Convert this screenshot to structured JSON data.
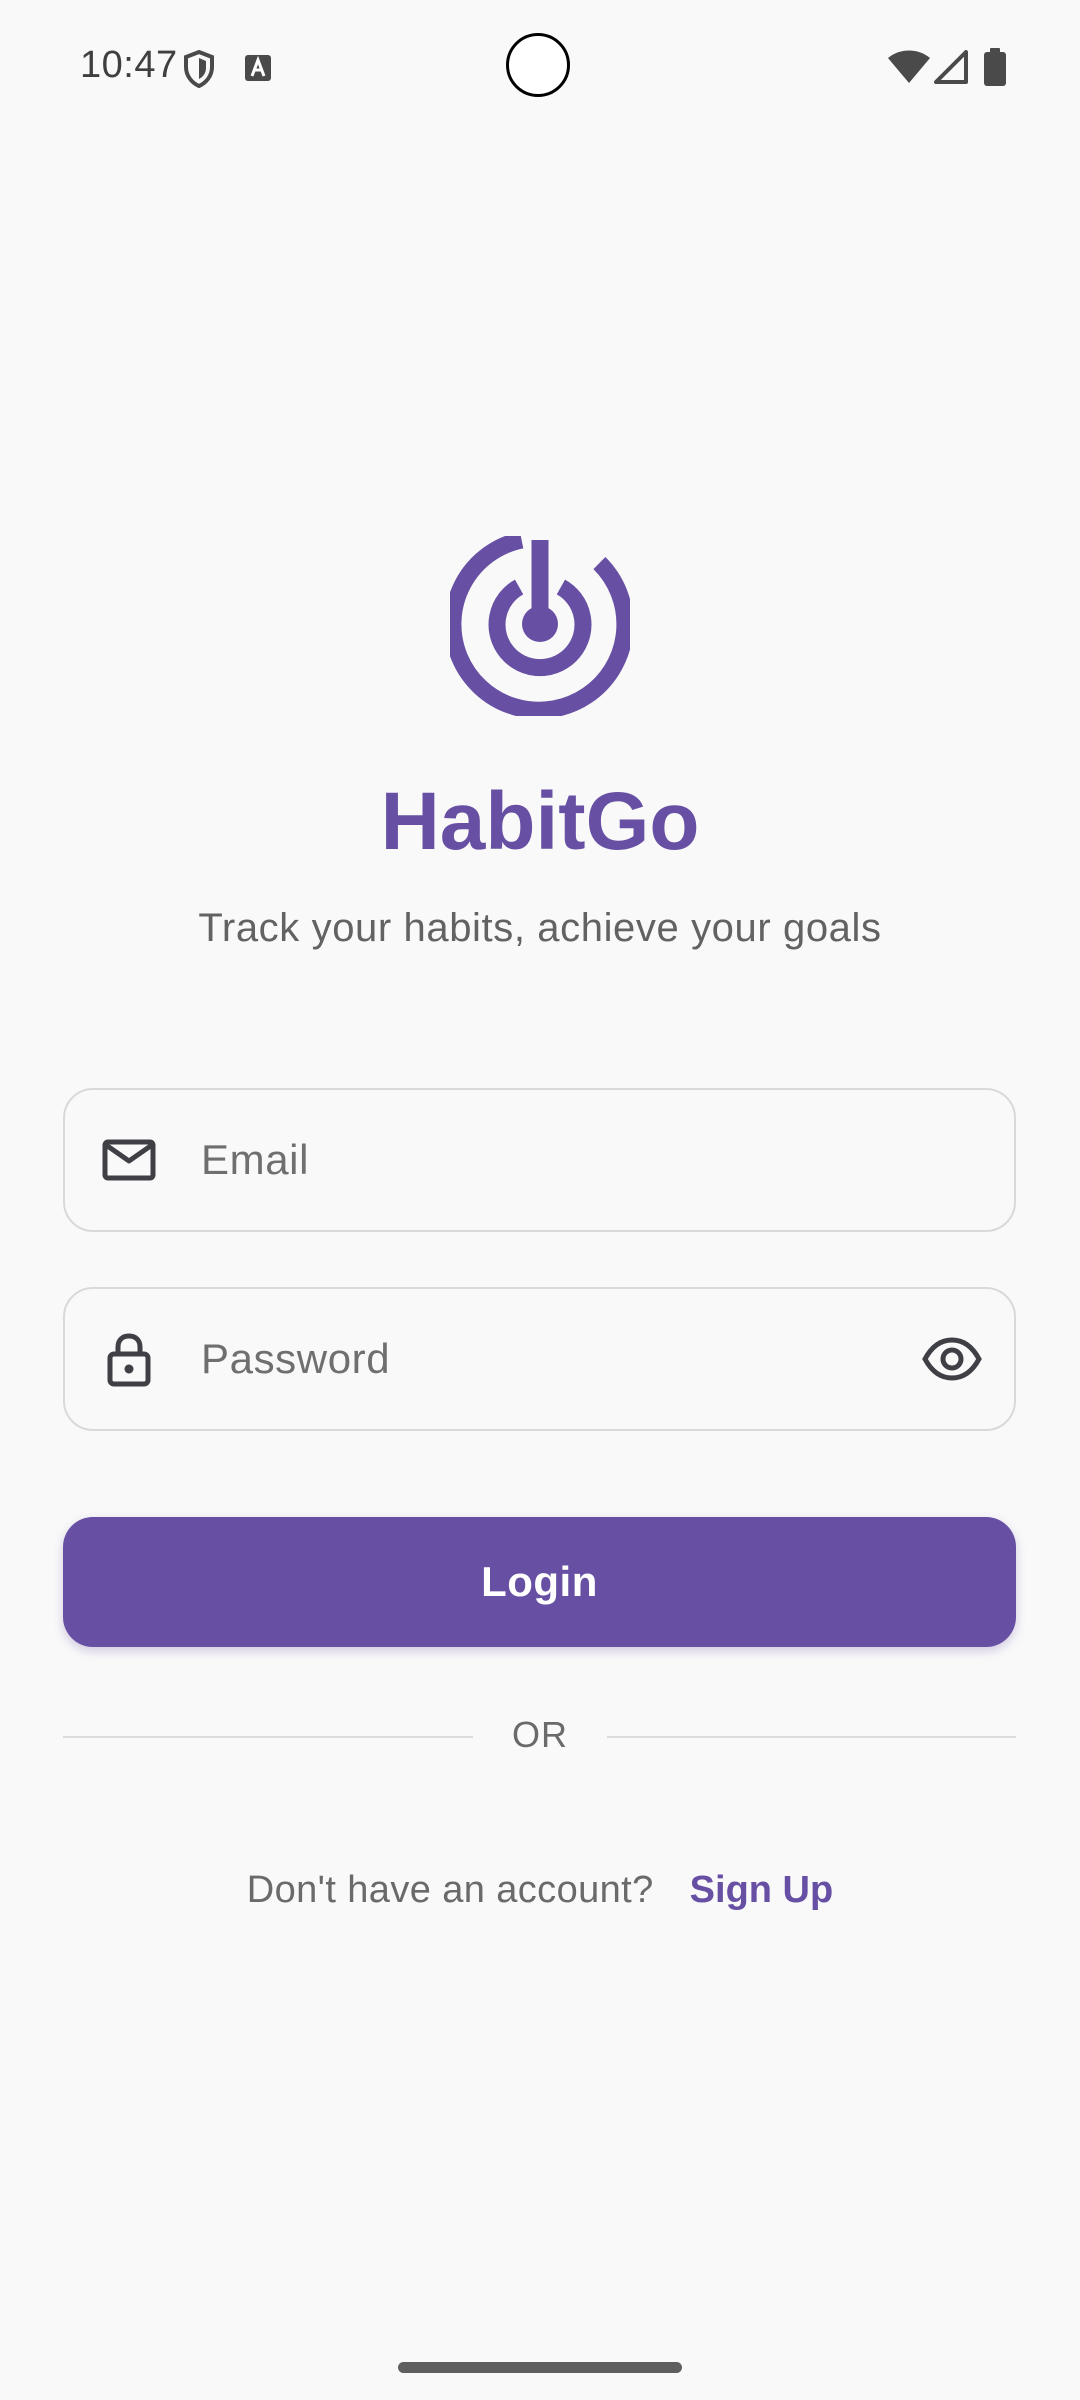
{
  "status_bar": {
    "time": "10:47",
    "icons": [
      "shield-icon",
      "font-a-icon",
      "wifi-icon",
      "signal-icon",
      "battery-icon"
    ]
  },
  "app": {
    "logo_icon": "target-power-icon",
    "title": "HabitGo",
    "subtitle": "Track your habits, achieve your goals",
    "accent_color": "#6750a4"
  },
  "form": {
    "email": {
      "icon": "mail-icon",
      "placeholder": "Email",
      "value": ""
    },
    "password": {
      "icon": "lock-icon",
      "placeholder": "Password",
      "value": "",
      "toggle_icon": "eye-icon"
    },
    "login_label": "Login"
  },
  "divider": {
    "text": "OR"
  },
  "signup": {
    "prompt": "Don't have an account?",
    "link_label": "Sign Up"
  }
}
